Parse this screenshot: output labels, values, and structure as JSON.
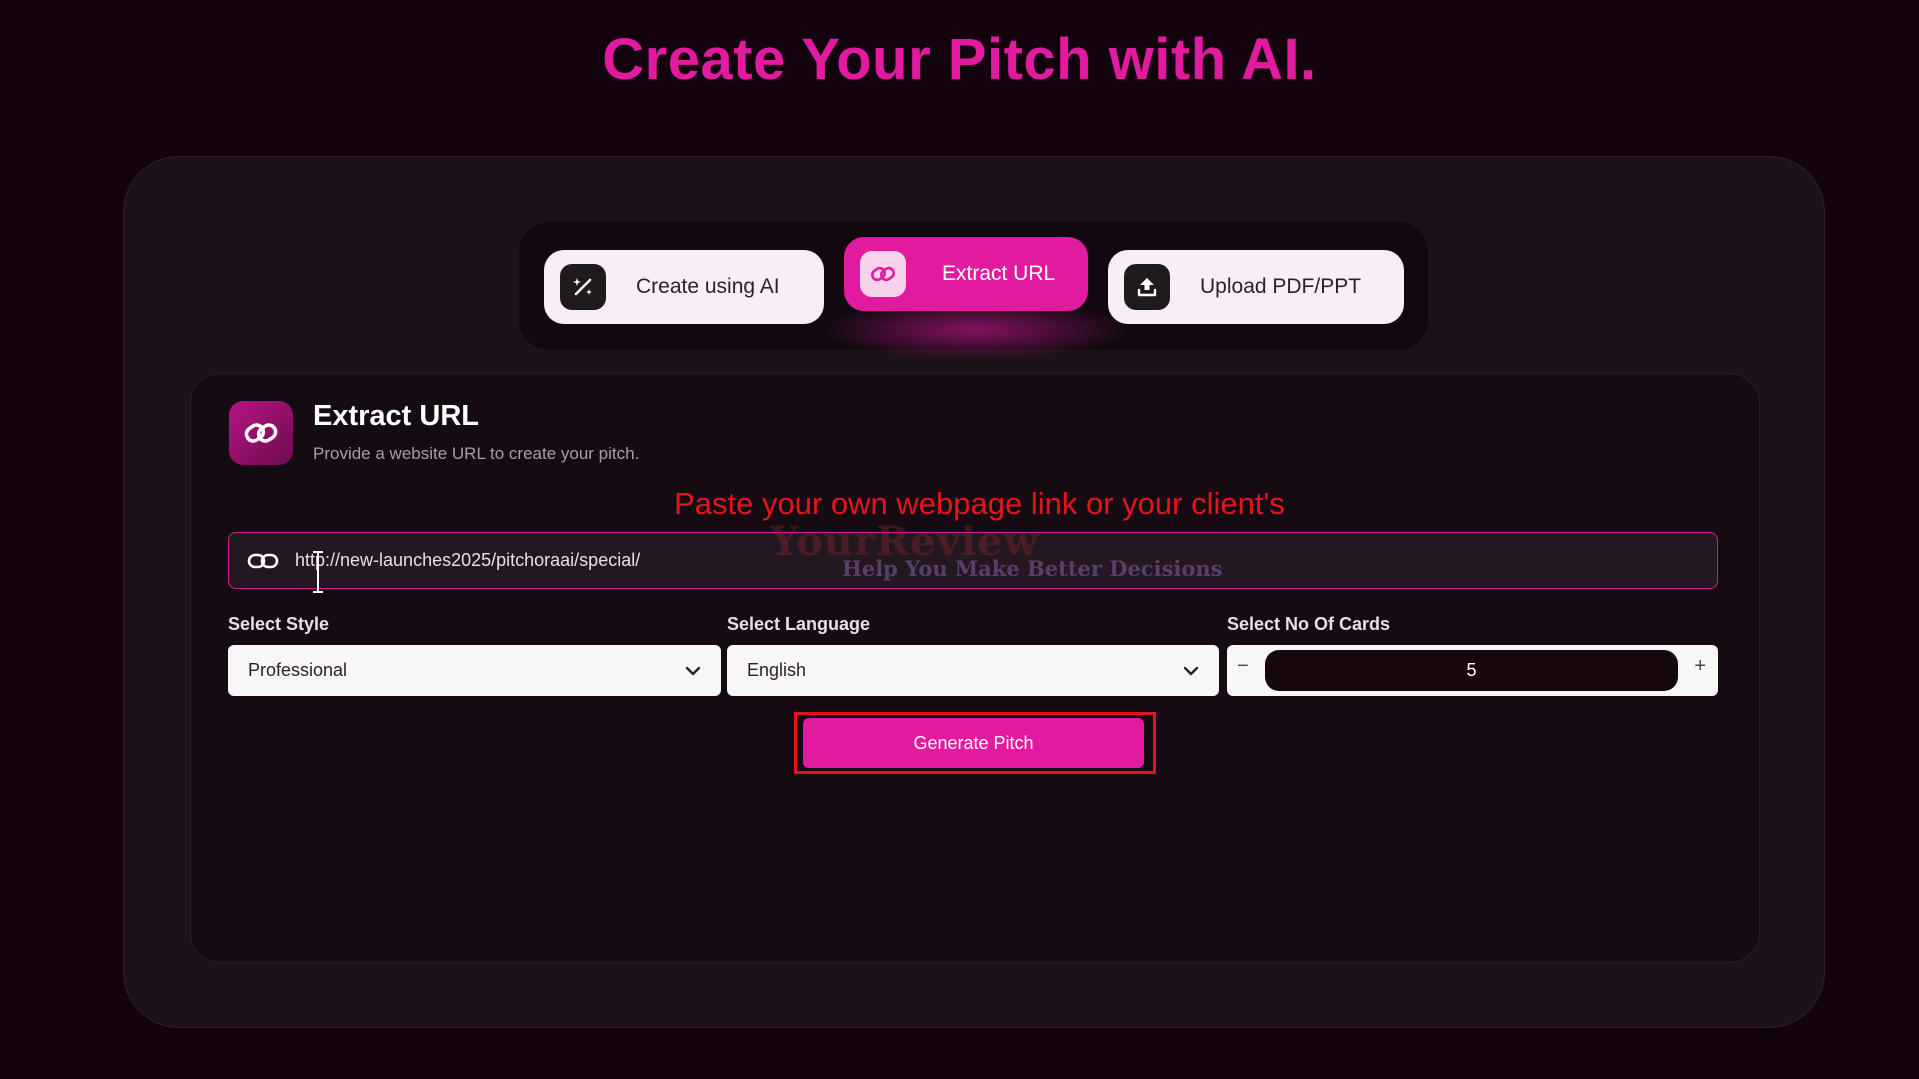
{
  "page": {
    "title": "Create Your Pitch with AI."
  },
  "tabs": [
    {
      "label": "Create using AI",
      "icon": "magic-wand-icon",
      "active": false
    },
    {
      "label": "Extract URL",
      "icon": "link-icon",
      "active": true
    },
    {
      "label": "Upload PDF/PPT",
      "icon": "upload-icon",
      "active": false
    }
  ],
  "section": {
    "title": "Extract URL",
    "subtitle": "Provide a website URL to create your pitch.",
    "icon": "link-icon"
  },
  "annotation": {
    "text": "Paste your own webpage link or your client's"
  },
  "url_input": {
    "value": "http://new-launches2025/pitchoraai/special/",
    "icon": "link-icon"
  },
  "watermark": {
    "title": "YourReview",
    "tagline": "Help You Make Better Decisions"
  },
  "fields": {
    "style": {
      "label": "Select Style",
      "value": "Professional"
    },
    "language": {
      "label": "Select Language",
      "value": "English"
    },
    "cards": {
      "label": "Select No Of Cards",
      "value": "5",
      "minus": "−",
      "plus": "+"
    }
  },
  "generate_button": {
    "label": "Generate Pitch"
  },
  "colors": {
    "accent": "#e21aa0",
    "background": "#12030f",
    "annotation_red": "#e8121e"
  }
}
